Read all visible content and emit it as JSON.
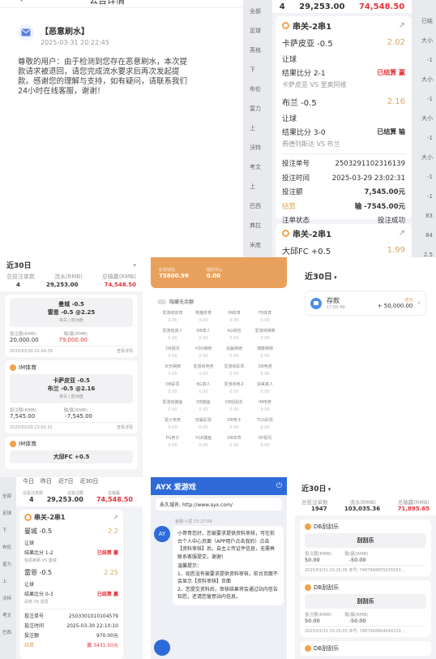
{
  "p1": {
    "title": "公告详情",
    "sender": "【恶意刷水】",
    "time": "2025-03-31 20:22:45",
    "body": "尊敬的用户：由于检测到您存在恶意刷水，本次提款请求被退回，请您完成流水要求后再次发起提款。感谢您的理解与支持，如有疑问，请联系我们24小时在线客服，谢谢！"
  },
  "p2": {
    "sum_count": "4",
    "sum_flow": "29,253.00",
    "sum_win": "74,548.50",
    "sl": [
      "全部",
      "足球",
      "英格",
      "下",
      "布伦",
      "富力",
      "上",
      "沃特",
      "考文",
      "上",
      "巴西",
      "弗拉",
      "米底"
    ],
    "sr": [
      "已结",
      "大小",
      "-1",
      "大小",
      "-1",
      "大小",
      "-1",
      "大小",
      "-1",
      "-1",
      "83",
      "84",
      "2.5"
    ],
    "title": "串关-2串1",
    "leg1": {
      "team": "卡萨皮亚  -0.5",
      "odds": "2.02",
      "type": "让球",
      "score": "结果比分  2-1",
      "status": "已结算 赢",
      "match": "卡萨皮亚 VS 里奥阿维"
    },
    "leg2": {
      "team": "布兰  -0.5",
      "odds": "2.16",
      "type": "让球",
      "score": "结果比分  3-0",
      "status": "已结算 输",
      "match": "费德列斯达 VS 布兰"
    },
    "no_l": "投注单号",
    "no": "2503291102316139",
    "time_l": "投注时间",
    "time": "2025-03-29 23:02:31",
    "amt_l": "投注额",
    "amt": "7,545.00元",
    "res_l": "结算",
    "res": "输 -7545.00元",
    "st_l": "注单状态",
    "st": "投注成功",
    "title2": "串关-2串1",
    "leg3": {
      "team": "大邱FC  +0.5",
      "odds": "1.99"
    }
  },
  "p3": {
    "period": "近30日",
    "h": [
      "总投注单数",
      "流水(RMB)",
      "总输赢(RMB)"
    ],
    "v": [
      "4",
      "29,253.00",
      "74,548.50"
    ],
    "c1": {
      "a": "曼城 -0.5",
      "b": "雷恩 -0.5 @2.25",
      "c": "串关 | 欧洲盘",
      "l1": "投注额(RMB)",
      "v1": "20,000.00",
      "l2": "输/赢(RMB)",
      "v2": "79,000.00",
      "t": "2025/03/30 22:09:39",
      "link": "查看详情"
    },
    "c2": {
      "src": "IM体育",
      "a": "卡萨皮亚 -0.5",
      "b": "布兰 -0.5 @2.16",
      "c": "串关 | 欧洲盘",
      "l1": "投注额(RMB)",
      "v1": "7,545.00",
      "l2": "输/赢(RMB)",
      "v2": "-7,545.00",
      "t": "2025/03/29 23:02:31",
      "link": "查看详情"
    },
    "c3": {
      "src": "IM体育",
      "a": "大邱FC +0.5"
    }
  },
  "p4": {
    "b1": "彩票钱包",
    "b2": "福利中心",
    "v1": "75800.99",
    "v2": "0.00",
    "hide": "隐藏无余额",
    "games": [
      "爱游戏体育",
      "熊猫体育",
      "IM体育",
      "FB体育",
      "爱游戏真人",
      "DB真人",
      "AG钱包",
      "爱游戏棋牌",
      "DB视讯",
      "YOO棋牌",
      "双赢棋牌",
      "博雅棋牌",
      "天天棋牌",
      "爱游戏电竞",
      "爱游戏彩票",
      "DB电竞",
      "DB彩票",
      "BG真人",
      "爱游戏电子",
      "完美真人",
      "爱游戏捕鱼",
      "DB捕鱼",
      "DB刮刮乐",
      "IM电竞",
      "雷火电竞",
      "双赢彩票",
      "DB电子",
      "TCG彩票",
      "PG电子",
      "YGR捕鱼",
      "DB体育",
      "SP视讯"
    ],
    "zero": "0.00"
  },
  "p5": {
    "period": "近30日",
    "label": "存款",
    "time": "17:05:49",
    "status": "成功",
    "amount": "+ 50,000.00"
  },
  "p6": {
    "tabs": [
      "今日",
      "昨日",
      "近7日",
      "近30日"
    ],
    "h": [
      "总投注单数",
      "总投注额",
      "总输赢"
    ],
    "v": [
      "4",
      "29,253.00",
      "74,548.50"
    ],
    "title": "串关-2串1",
    "sl": [
      "全部",
      "足球",
      "下",
      "布伦",
      "富力",
      "上",
      "沃特",
      "考文",
      "巴西"
    ],
    "leg1": {
      "team": "曼城  -0.5",
      "odds": "2.2",
      "type": "让球",
      "score": "结果比分  1-2",
      "status": "已结算 赢",
      "match": "伯恩茅斯 VS 曼城"
    },
    "leg2": {
      "team": "雷恩  -0.5",
      "odds": "2.25",
      "type": "让球",
      "score": "结果比分  0-3",
      "status": "已结算 赢",
      "match": "昂热 VS 雷恩"
    },
    "no_l": "投注单号",
    "no": "2503301010104579",
    "time_l": "投注时间",
    "time": "2025-03-30 22:10:10",
    "amt_l": "投注额",
    "amt": "970.00元",
    "res_l": "结算",
    "res": "赢 3431.50元"
  },
  "p7": {
    "logo": "AYX 爱游戏",
    "url_l": "永久域名:",
    "url": "http://www.ayx.com/",
    "sender": "客服·小爱 15:27:09",
    "msg1": "小哥哥您好，您被要求提供资料审核，可在前台个人中心页面（APP用户点击我的）点击【资料审核】后，自主上传证件信息，无需再联系客服提交，谢谢!",
    "tip": "温馨提示：",
    "msg2": "1、如您没有被要求提供资料审核，前台页面不会显示【资料审核】页面",
    "msg3": "2、您提交资料后，审核结果将会通过站内信告知您，还请您留意站内信息。"
  },
  "p8": {
    "period": "近30日",
    "h": [
      "总投注单数",
      "流水(RMB)",
      "总输赢(RMB)"
    ],
    "v": [
      "1947",
      "103,035.36",
      "71,895.65"
    ],
    "src": "DB刮刮乐",
    "game": "刮刮乐",
    "l1": "投注额(RMB)",
    "l2": "输/赢(RMB)",
    "v1": "50.00",
    "v2": "-50.00",
    "r1": "2025/03/31 20:25:05  单号: 7487948655070163...",
    "r2": "2025/03/31 20:25:03  单号: 7487948664640229..."
  }
}
